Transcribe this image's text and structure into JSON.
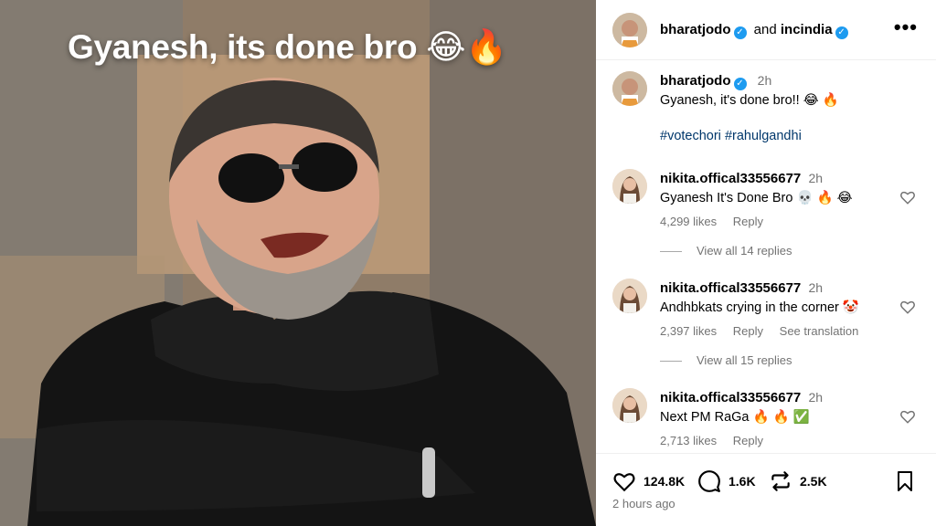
{
  "media": {
    "caption": "Gyanesh, its done bro 😂🔥"
  },
  "header": {
    "author": "bharatjodo",
    "joiner": "and",
    "collaborator": "incindia",
    "more": "•••"
  },
  "post": {
    "author": "bharatjodo",
    "time": "2h",
    "text": "Gyanesh, it's done bro!! 😂 🔥",
    "hashtags": [
      "#votechori",
      "#rahulgandhi"
    ]
  },
  "comments": [
    {
      "username": "nikita.offical33556677",
      "time": "2h",
      "text": "Gyanesh It's Done Bro  💀 🔥 😂",
      "likes": "4,299 likes",
      "reply": "Reply",
      "translate": "",
      "view_replies": "View all 14 replies"
    },
    {
      "username": "nikita.offical33556677",
      "time": "2h",
      "text": "Andhbkats crying in the corner 🤡",
      "likes": "2,397 likes",
      "reply": "Reply",
      "translate": "See translation",
      "view_replies": "View all 15 replies"
    },
    {
      "username": "nikita.offical33556677",
      "time": "2h",
      "text": "Next PM RaGa 🔥 🔥 ✅",
      "likes": "2,713 likes",
      "reply": "Reply",
      "translate": "",
      "view_replies": ""
    }
  ],
  "actions": {
    "likes": "124.8K",
    "comments": "1.6K",
    "reposts": "2.5K",
    "posted_ago": "2 hours ago"
  },
  "icons": {
    "verified": "verified-badge-icon",
    "more": "more-options-icon",
    "like": "heart-icon",
    "comment": "comment-bubble-icon",
    "repost": "repost-icon",
    "save": "bookmark-icon"
  },
  "colors": {
    "verified": "#1d9bf0",
    "hashtag": "#00376b",
    "secondary_text": "#737373"
  }
}
